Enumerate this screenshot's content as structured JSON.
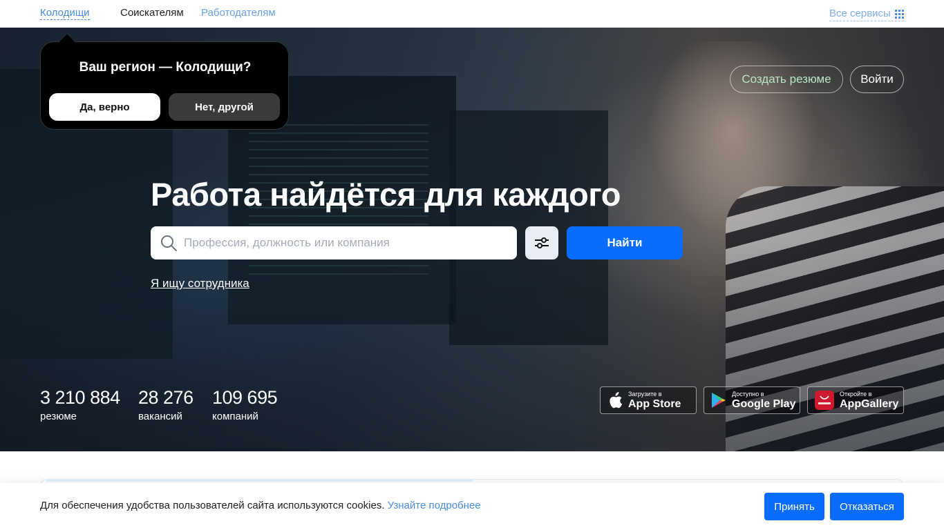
{
  "topnav": {
    "region": "Колодищи",
    "seekers": "Соискателям",
    "employers": "Работодателям",
    "services": "Все сервисы"
  },
  "region_popup": {
    "question": "Ваш регион — Колодищи?",
    "yes": "Да, верно",
    "no": "Нет, другой"
  },
  "hero": {
    "create_resume": "Создать резюме",
    "login": "Войти",
    "headline": "Работа найдётся для каждого",
    "search_placeholder": "Профессия, должность или компания",
    "search_value": "",
    "find_button": "Найти",
    "employer_link": "Я ищу сотрудника"
  },
  "stats": [
    {
      "value": "3 210 884",
      "label": "резюме"
    },
    {
      "value": "28 276",
      "label": "вакансий"
    },
    {
      "value": "109 695",
      "label": "компаний"
    }
  ],
  "stores": [
    {
      "small": "Загрузите в",
      "big": "App Store",
      "icon": "apple-icon"
    },
    {
      "small": "Доступно в",
      "big": "Google Play",
      "icon": "google-play-icon"
    },
    {
      "small": "Откройте в",
      "big": "AppGallery",
      "icon": "huawei-icon"
    }
  ],
  "cookie": {
    "message": "Для обеспечения удобства пользователей сайта используются cookies.",
    "more": "Узнайте подробнее",
    "accept": "Принять",
    "decline": "Отказаться"
  },
  "colors": {
    "accent": "#0a6cff",
    "link": "#4a8ee0",
    "resume_button_text": "#b8e6c2"
  }
}
